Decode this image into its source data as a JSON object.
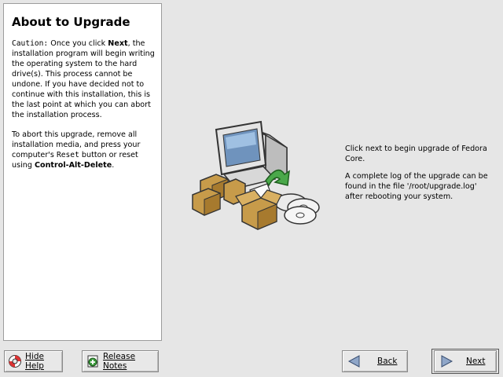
{
  "help": {
    "title": "About to Upgrade",
    "caution_label": "Caution:",
    "para1_a": " Once you click ",
    "para1_next": "Next",
    "para1_b": ", the installation program will begin writing the operating system to the hard drive(s). This process cannot be undone. If you have decided not to continue with this installation, this is the last point at which you can abort the installation process.",
    "para2_a": "To abort this upgrade, remove all installation media, and press your computer's ",
    "para2_reset": "Reset",
    "para2_b": " button or reset using ",
    "para2_keys": "Control-Alt-Delete",
    "para2_c": "."
  },
  "main": {
    "line1": "Click next to begin upgrade of Fedora Core.",
    "line2": "A complete log of the upgrade can be found in the file '/root/upgrade.log' after rebooting your system."
  },
  "buttons": {
    "hide_help": "Hide Help",
    "release_notes": "Release Notes",
    "back": "Back",
    "next": "Next"
  },
  "icons": {
    "hide_help": "lifebuoy-icon",
    "release_notes": "notes-add-icon",
    "back": "back-arrow-icon",
    "next": "next-arrow-icon"
  }
}
